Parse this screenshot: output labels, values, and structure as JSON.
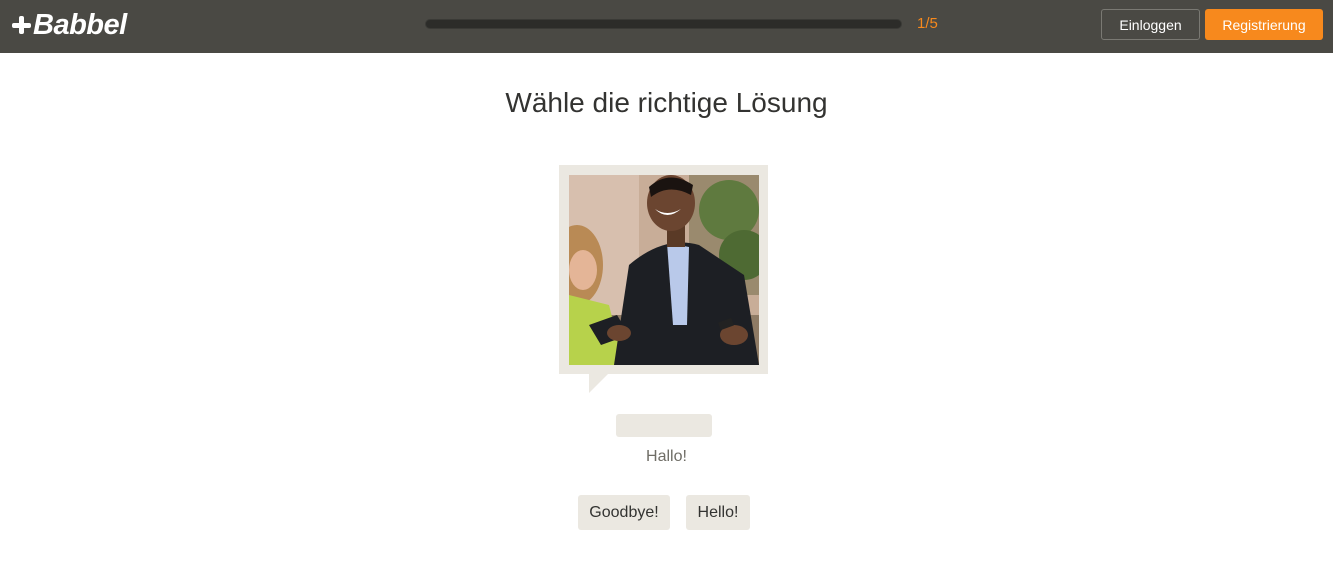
{
  "header": {
    "logo_text": "Babbel",
    "progress": {
      "current": 1,
      "total": 5,
      "label": "1/5",
      "fraction": 0.0
    },
    "login_label": "Einloggen",
    "register_label": "Registrierung"
  },
  "exercise": {
    "instruction": "Wähle die richtige Lösung",
    "image": "handshake-photo",
    "translation": "Hallo!",
    "choices": [
      "Goodbye!",
      "Hello!"
    ]
  },
  "colors": {
    "topbar": "#4a4944",
    "accent": "#f7891d",
    "card": "#ebe8e1"
  }
}
